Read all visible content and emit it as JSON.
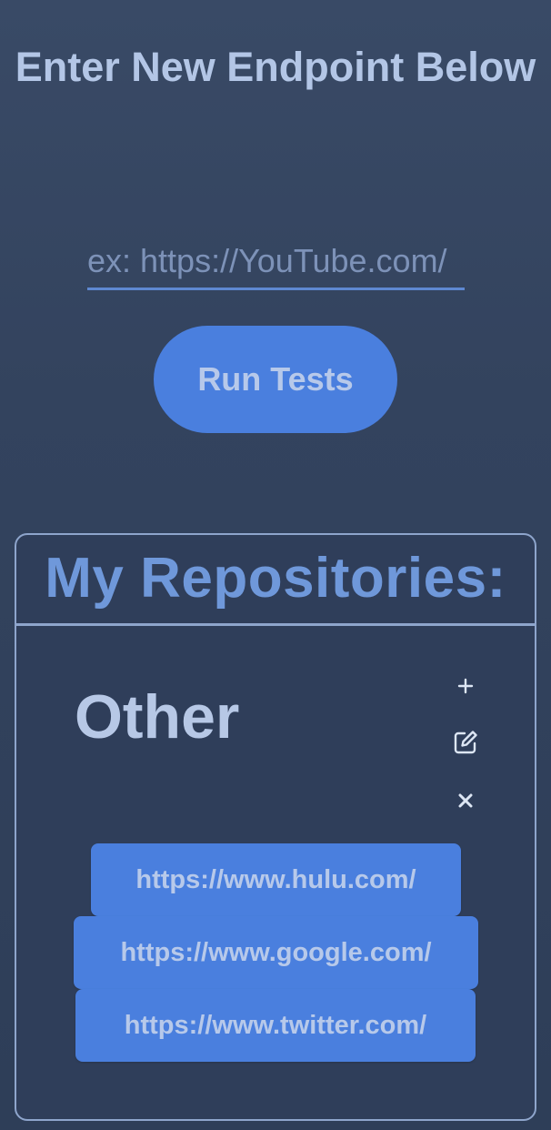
{
  "header": {
    "title": "Enter New Endpoint Below"
  },
  "endpoint_input": {
    "placeholder": "ex: https://YouTube.com/",
    "value": ""
  },
  "run_button": {
    "label": "Run Tests"
  },
  "repositories": {
    "title": "My Repositories:",
    "groups": [
      {
        "name": "Other",
        "actions": [
          "plus-icon",
          "edit-icon",
          "close-icon"
        ],
        "links": [
          "https://www.hulu.com/",
          "https://www.google.com/",
          "https://www.twitter.com/"
        ]
      }
    ]
  },
  "colors": {
    "background": "#33435e",
    "accent": "#4a7fde",
    "text": "#b3c6e6",
    "repo_title": "#6f98da",
    "border": "#8ea5cc"
  }
}
